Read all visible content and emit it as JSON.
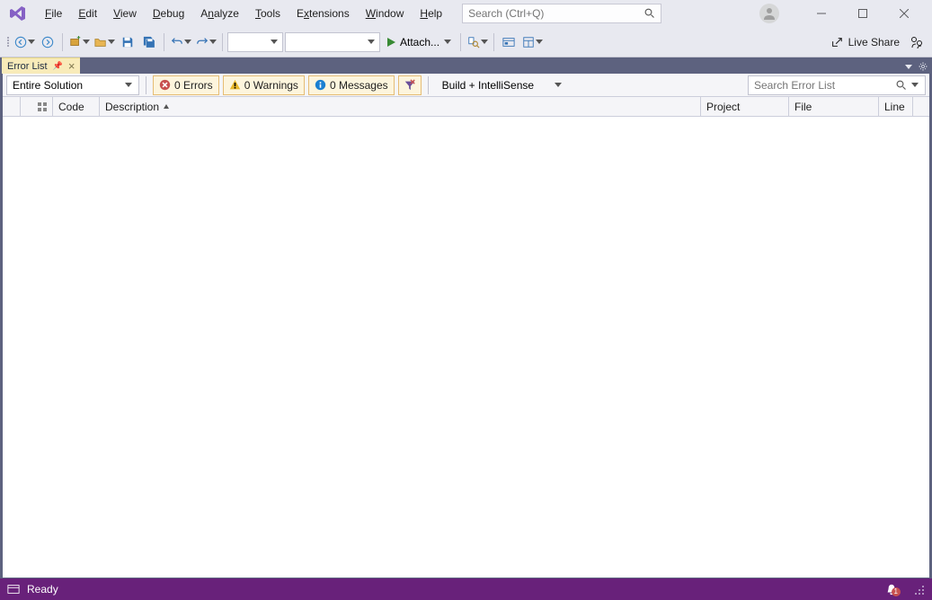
{
  "menu": {
    "items": [
      {
        "key": "F",
        "label": "File"
      },
      {
        "key": "E",
        "label": "Edit"
      },
      {
        "key": "V",
        "label": "View"
      },
      {
        "key": "D",
        "label": "Debug"
      },
      {
        "key": "A",
        "label": "Analyze"
      },
      {
        "key": "T",
        "label": "Tools"
      },
      {
        "key": "x",
        "label": "Extensions"
      },
      {
        "key": "W",
        "label": "Window"
      },
      {
        "key": "H",
        "label": "Help"
      }
    ],
    "search_placeholder": "Search (Ctrl+Q)"
  },
  "toolbar": {
    "attach_label": "Attach...",
    "live_share_label": "Live Share"
  },
  "error_list": {
    "tab_title": "Error List",
    "scope": "Entire Solution",
    "errors_label": "0 Errors",
    "warnings_label": "0 Warnings",
    "messages_label": "0 Messages",
    "build_mode": "Build + IntelliSense",
    "search_placeholder": "Search Error List",
    "columns": {
      "code": "Code",
      "description": "Description",
      "project": "Project",
      "file": "File",
      "line": "Line"
    }
  },
  "status": {
    "ready": "Ready",
    "notif_count": "1"
  }
}
